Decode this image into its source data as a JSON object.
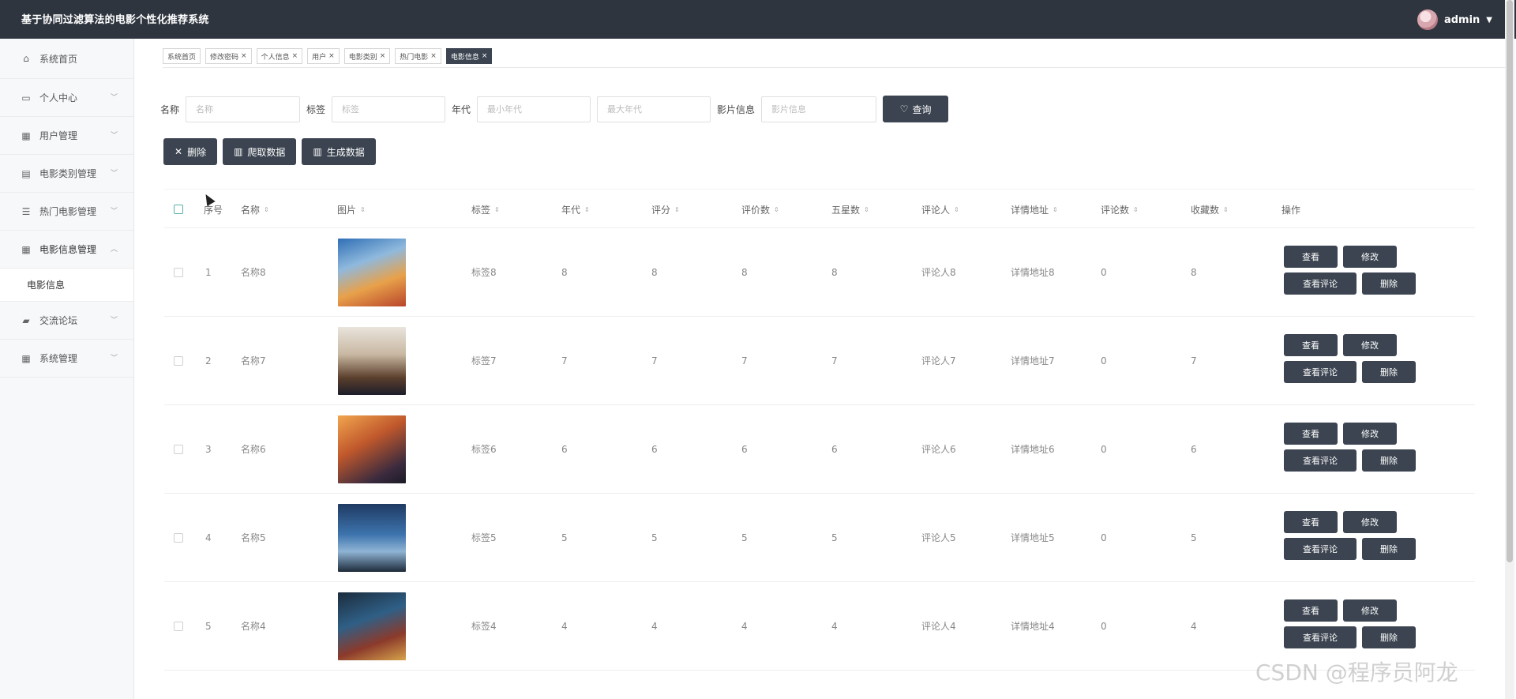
{
  "app": {
    "title": "基于协同过滤算法的电影个性化推荐系统",
    "user": "admin"
  },
  "sidebar": {
    "items": [
      {
        "label": "系统首页",
        "icon": "home-icon"
      },
      {
        "label": "个人中心",
        "icon": "calendar-icon"
      },
      {
        "label": "用户管理",
        "icon": "grid-icon"
      },
      {
        "label": "电影类别管理",
        "icon": "clipboard-icon"
      },
      {
        "label": "热门电影管理",
        "icon": "sliders-icon"
      },
      {
        "label": "电影信息管理",
        "icon": "table-icon"
      },
      {
        "label": "交流论坛",
        "icon": "forum-icon"
      },
      {
        "label": "系统管理",
        "icon": "grid-icon"
      }
    ],
    "sub_item": "电影信息"
  },
  "tags": [
    "系统首页",
    "修改密码",
    "个人信息",
    "用户",
    "电影类别",
    "热门电影",
    "电影信息"
  ],
  "search": {
    "name_label": "名称",
    "name_ph": "名称",
    "tag_label": "标签",
    "tag_ph": "标签",
    "year_label": "年代",
    "year_min_ph": "最小年代",
    "year_max_ph": "最大年代",
    "info_label": "影片信息",
    "info_ph": "影片信息",
    "query": "查询"
  },
  "actions": {
    "delete": "删除",
    "crawl": "爬取数据",
    "generate": "生成数据"
  },
  "table": {
    "headers": [
      "序号",
      "名称",
      "图片",
      "标签",
      "年代",
      "评分",
      "评价数",
      "五星数",
      "评论人",
      "详情地址",
      "评论数",
      "收藏数",
      "操作"
    ],
    "rows": [
      {
        "idx": "1",
        "name": "名称8",
        "tag": "标签8",
        "year": "8",
        "score": "8",
        "rates": "8",
        "five": "8",
        "reviewer": "评论人8",
        "url": "详情地址8",
        "comments": "0",
        "fav": "8"
      },
      {
        "idx": "2",
        "name": "名称7",
        "tag": "标签7",
        "year": "7",
        "score": "7",
        "rates": "7",
        "five": "7",
        "reviewer": "评论人7",
        "url": "详情地址7",
        "comments": "0",
        "fav": "7"
      },
      {
        "idx": "3",
        "name": "名称6",
        "tag": "标签6",
        "year": "6",
        "score": "6",
        "rates": "6",
        "five": "6",
        "reviewer": "评论人6",
        "url": "详情地址6",
        "comments": "0",
        "fav": "6"
      },
      {
        "idx": "4",
        "name": "名称5",
        "tag": "标签5",
        "year": "5",
        "score": "5",
        "rates": "5",
        "five": "5",
        "reviewer": "评论人5",
        "url": "详情地址5",
        "comments": "0",
        "fav": "5"
      },
      {
        "idx": "5",
        "name": "名称4",
        "tag": "标签4",
        "year": "4",
        "score": "4",
        "rates": "4",
        "five": "4",
        "reviewer": "评论人4",
        "url": "详情地址4",
        "comments": "0",
        "fav": "4"
      }
    ],
    "btn_view": "查看",
    "btn_edit": "修改",
    "btn_comments": "查看评论",
    "btn_delete": "删除"
  },
  "watermark": "CSDN @程序员阿龙",
  "colors": {
    "topbar": "#2e353f",
    "button": "#3b4450",
    "sidebar_bg": "#f7f8fa"
  }
}
